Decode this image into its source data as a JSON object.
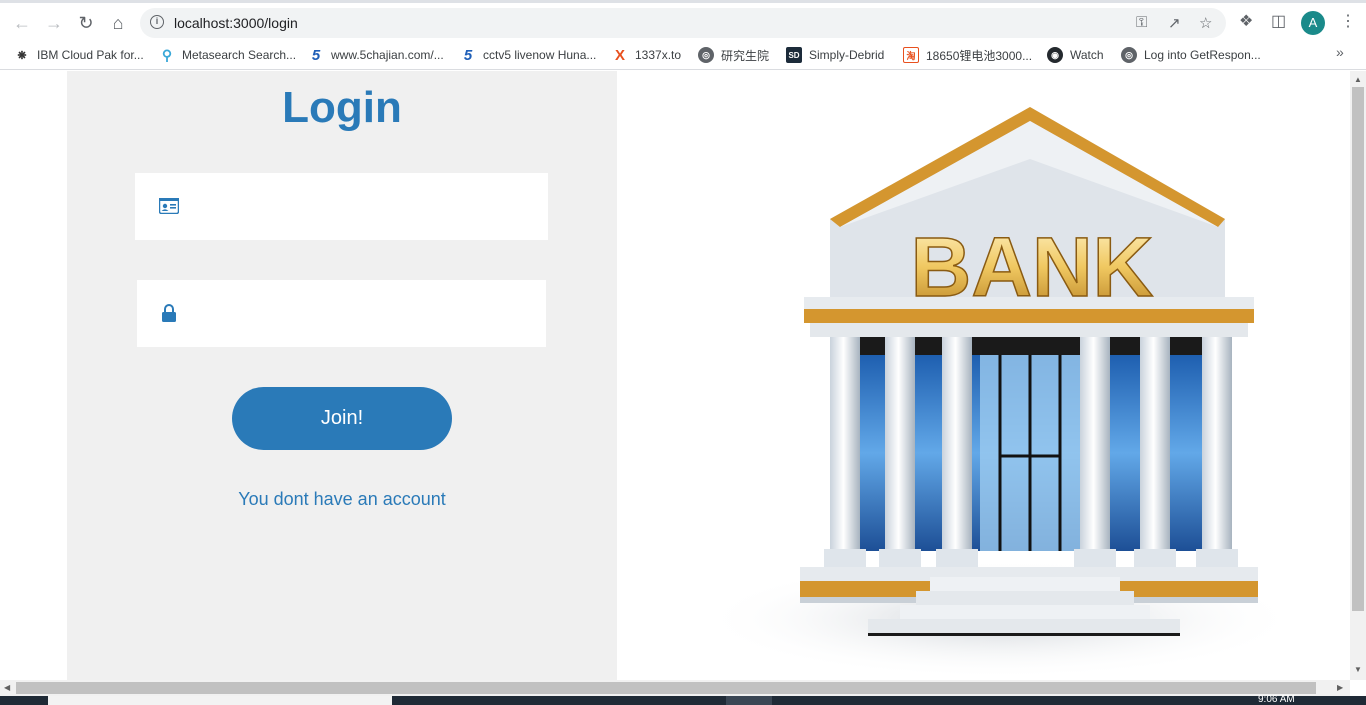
{
  "browser": {
    "url": "localhost:3000/login",
    "avatar_letter": "A",
    "bookmarks": [
      {
        "label": "IBM Cloud Pak for...",
        "icon": "bee-icon"
      },
      {
        "label": "Metasearch Search...",
        "icon": "magnifier-icon"
      },
      {
        "label": "www.5chajian.com/...",
        "icon": "five-icon"
      },
      {
        "label": "cctv5 livenow Huna...",
        "icon": "five-icon"
      },
      {
        "label": "1337x.to",
        "icon": "x-icon"
      },
      {
        "label": "研究生院",
        "icon": "globe-icon"
      },
      {
        "label": "Simply-Debrid",
        "icon": "sd-icon"
      },
      {
        "label": "18650锂电池3000...",
        "icon": "taobao-icon"
      },
      {
        "label": "Watch",
        "icon": "github-icon"
      },
      {
        "label": "Log into GetRespon...",
        "icon": "globe-icon"
      }
    ]
  },
  "login": {
    "title": "Login",
    "username_placeholder": "",
    "password_placeholder": "",
    "submit_label": "Join!",
    "account_link": "You dont have an account"
  },
  "illustration": {
    "sign_text": "BANK"
  },
  "taskbar": {
    "clock": "9:06 AM"
  },
  "colors": {
    "accent": "#2a7ab8",
    "panel_bg": "#f0f0f0",
    "gold": "#d4962f"
  }
}
